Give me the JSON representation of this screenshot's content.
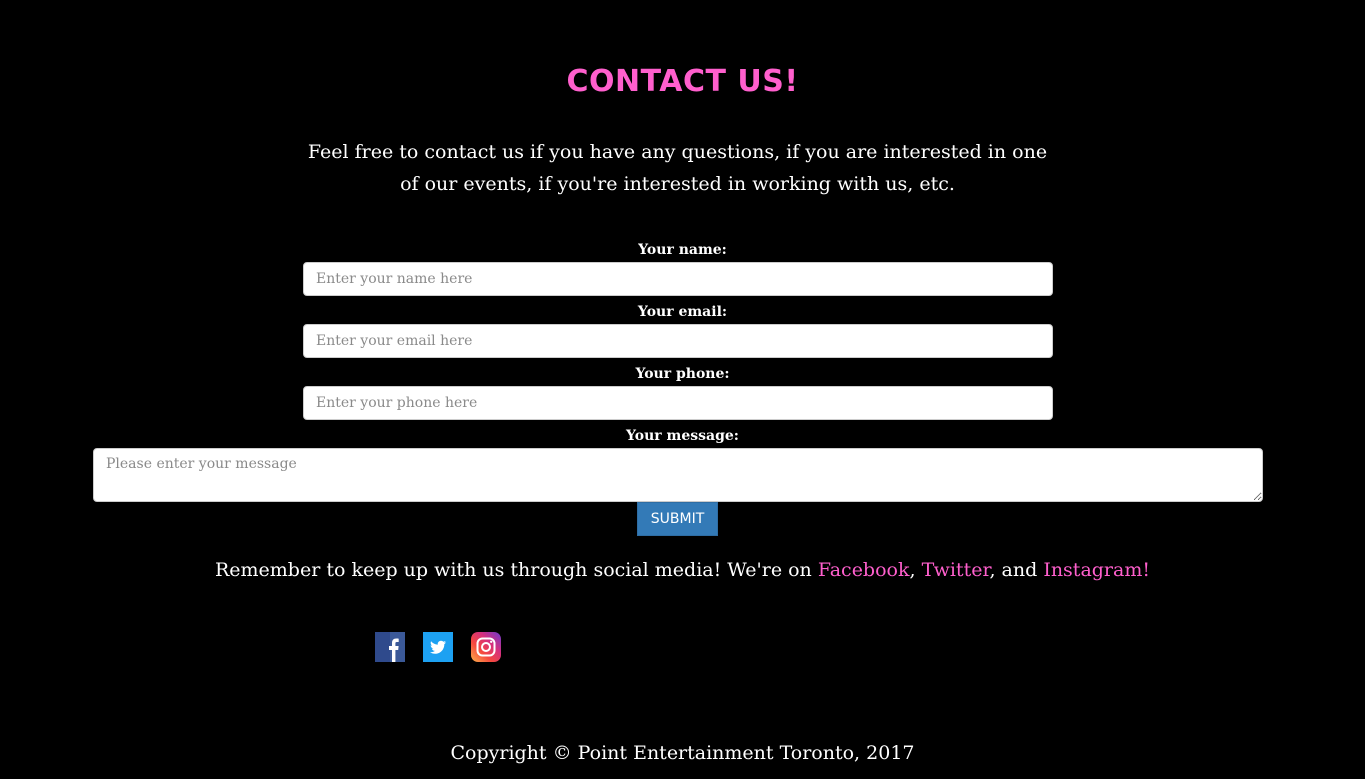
{
  "heading": "CONTACT US!",
  "intro": "Feel free to contact us if you have any questions, if you are interested in one of our events, if you're interested in working with us, etc.",
  "form": {
    "name_label": "Your name:",
    "name_placeholder": "Enter your name here",
    "name_value": "",
    "email_label": "Your email:",
    "email_placeholder": "Enter your email here",
    "email_value": "",
    "phone_label": "Your phone:",
    "phone_placeholder": "Enter your phone here",
    "phone_value": "",
    "message_label": "Your message:",
    "message_placeholder": "Please enter your message",
    "message_value": "",
    "submit_label": "SUBMIT"
  },
  "social": {
    "text_before": "Remember to keep up with us through social media! We're on ",
    "facebook": "Facebook",
    "sep1": ", ",
    "twitter": "Twitter",
    "sep2": ", and ",
    "instagram": "Instagram!",
    "icons": [
      "facebook-icon",
      "twitter-icon",
      "instagram-icon"
    ]
  },
  "footer": {
    "copyright": "Copyright © Point Entertainment Toronto, 2017"
  },
  "colors": {
    "background": "#000000",
    "accent": "#ff5fcd",
    "button": "#337ab7",
    "facebook": "#3b5998",
    "twitter": "#1da1f2"
  }
}
